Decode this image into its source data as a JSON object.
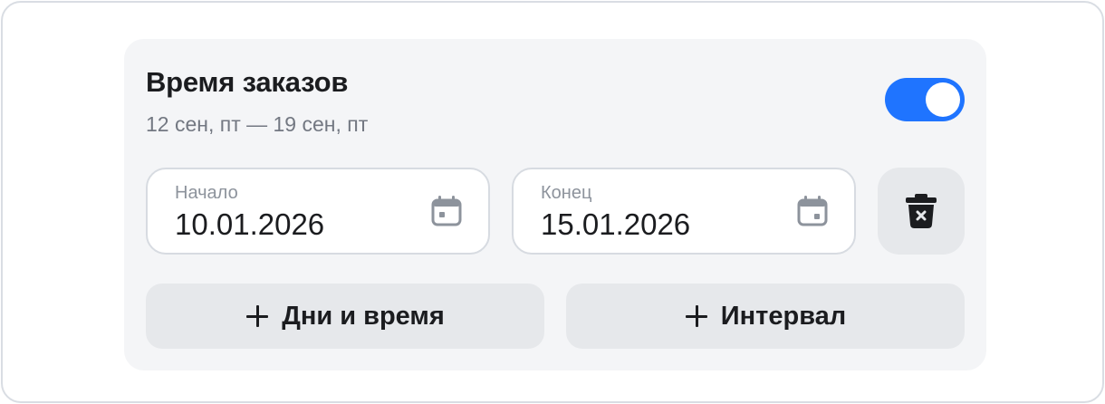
{
  "section": {
    "title": "Время заказов",
    "subtitle": "12 сен, пт — 19 сен, пт",
    "toggle_on": true,
    "accent_color": "#1f74ff"
  },
  "start_field": {
    "label": "Начало",
    "value": "10.01.2026",
    "icon": "calendar-icon"
  },
  "end_field": {
    "label": "Конец",
    "value": "15.01.2026",
    "icon": "calendar-icon"
  },
  "delete_button": {
    "icon": "trash-icon"
  },
  "actions": {
    "days_label": "Дни и время",
    "interval_label": "Интервал",
    "icon": "plus-icon"
  }
}
